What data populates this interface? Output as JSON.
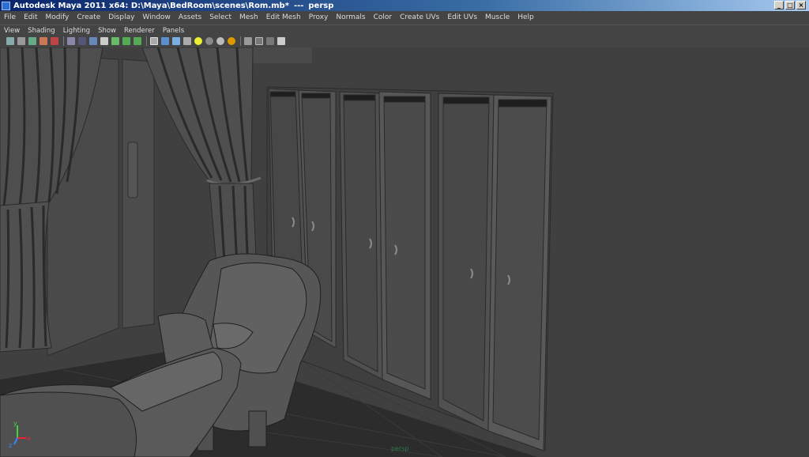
{
  "window": {
    "title": "Autodesk Maya 2011 x64: D:\\Maya\\BedRoom\\scenes\\Rom.mb*",
    "separator": "---",
    "view": "persp",
    "controls": [
      "_",
      "□",
      "×"
    ]
  },
  "menubar": [
    "File",
    "Edit",
    "Modify",
    "Create",
    "Display",
    "Window",
    "Assets",
    "Select",
    "Mesh",
    "Edit Mesh",
    "Proxy",
    "Normals",
    "Color",
    "Create UVs",
    "Edit UVs",
    "Muscle",
    "Help"
  ],
  "panel_menu": [
    "View",
    "Shading",
    "Lighting",
    "Show",
    "Renderer",
    "Panels"
  ],
  "toolbar_icons": [
    "camera-attributes-icon",
    "bookmark-icon",
    "image-plane-icon",
    "2d-pan-icon",
    "grease-pencil-icon",
    "grid-icon",
    "film-gate-icon",
    "resolution-gate-icon",
    "gate-mask-icon",
    "field-chart-icon",
    "safe-action-icon",
    "safe-title-icon",
    "wireframe-icon",
    "smooth-shade-icon",
    "wireframe-on-shaded-icon",
    "textured-icon",
    "use-all-lights-icon",
    "shadows-icon",
    "screen-space-ao-icon",
    "motion-blur-icon",
    "isolate-select-icon",
    "xray-icon",
    "xray-joints-icon",
    "xray-components-icon"
  ],
  "viewport": {
    "camera": "persp",
    "background_color": "#404040",
    "axis_labels": [
      "y",
      "x",
      "z"
    ]
  }
}
